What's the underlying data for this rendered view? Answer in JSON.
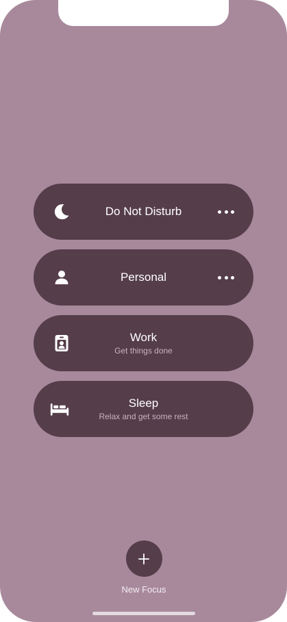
{
  "theme": {
    "background": "#a8899c",
    "row_color": "#553d4a",
    "text_color": "#ffffff",
    "subtext_color": "#c8b4bf"
  },
  "focus_modes": [
    {
      "title": "Do Not Disturb",
      "subtitle": "",
      "icon": "moon-icon",
      "has_more": true
    },
    {
      "title": "Personal",
      "subtitle": "",
      "icon": "person-icon",
      "has_more": true
    },
    {
      "title": "Work",
      "subtitle": "Get things done",
      "icon": "badge-icon",
      "has_more": false
    },
    {
      "title": "Sleep",
      "subtitle": "Relax and get some rest",
      "icon": "bed-icon",
      "has_more": false
    }
  ],
  "new_focus": {
    "label": "New Focus",
    "icon": "plus-icon"
  }
}
